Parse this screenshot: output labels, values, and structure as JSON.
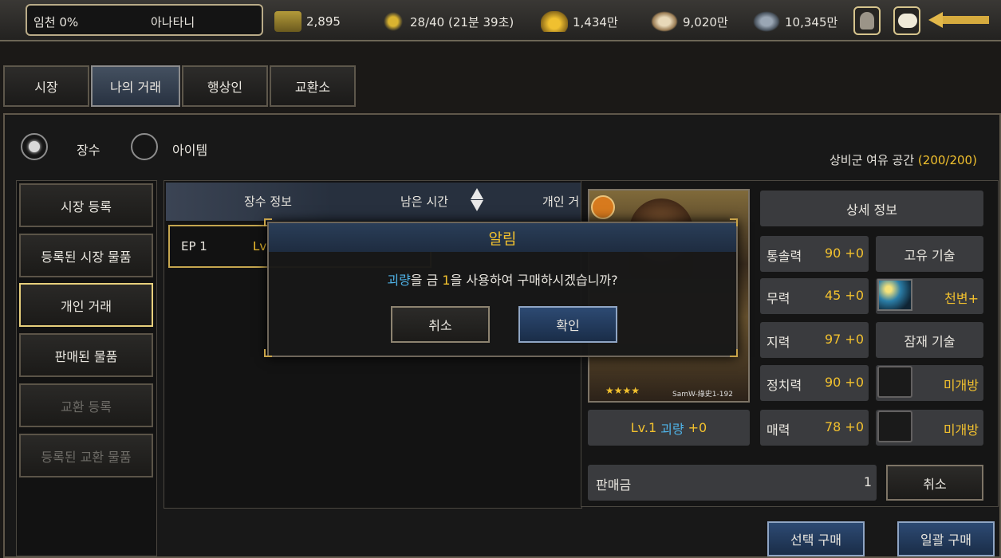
{
  "topbar": {
    "rank": "임천 0%",
    "nickname": "아나타니",
    "resources": [
      {
        "icon": "scroll-icon",
        "value": "2,895"
      },
      {
        "icon": "stamina-runner-icon",
        "value": "28/40 (21분 39초)"
      },
      {
        "icon": "gold-ingot-icon",
        "value": "1,434만"
      },
      {
        "icon": "food-sack-icon",
        "value": "9,020만"
      },
      {
        "icon": "iron-ore-icon",
        "value": "10,345만"
      }
    ]
  },
  "tabs": [
    "시장",
    "나의 거래",
    "행상인",
    "교환소"
  ],
  "filter": {
    "general": "장수",
    "item": "아이템"
  },
  "reserve_space": {
    "label": "상비군 여유 공간",
    "value": "(200/200)"
  },
  "sidebar": [
    "시장 등록",
    "등록된 시장 물품",
    "개인 거래",
    "판매된 물품",
    "교환 등록",
    "등록된 교환 물품"
  ],
  "list_header": {
    "info": "장수 정보",
    "time": "남은 시간",
    "personal": "개인 거"
  },
  "row": {
    "ep": "EP 1",
    "lv": "Lv"
  },
  "detail": {
    "card_stars": "★★★★",
    "card_caption": "SamW-綠史1-192",
    "level_prefix": "Lv.1",
    "general_name": "괴량",
    "level_suffix": "+0",
    "detail_info_btn": "상세 정보",
    "stats": [
      {
        "label": "통솔력",
        "value": "90 +0"
      },
      {
        "label": "무력",
        "value": "45 +0"
      },
      {
        "label": "지력",
        "value": "97 +0"
      },
      {
        "label": "정치력",
        "value": "90 +0"
      },
      {
        "label": "매력",
        "value": "78 +0"
      }
    ],
    "unique_skill_btn": "고유 기술",
    "unique_skill_name": "천변+",
    "potential_skill_btn": "잠재 기술",
    "slot1": "미개방",
    "slot2": "미개방",
    "price_label": "판매금",
    "price_value": "1",
    "cancel_btn": "취소"
  },
  "bottom": {
    "select_buy": "선택 구매",
    "bulk_buy": "일괄 구매"
  },
  "dialog": {
    "title": "알림",
    "name": "괴량",
    "msg_a": "을 금 ",
    "amount": "1",
    "msg_b": "을 사용하여 구매하시겠습니까?",
    "cancel": "취소",
    "confirm": "확인"
  },
  "colors": {
    "gold": "#f2c12e",
    "cyan": "#4fb3e8"
  }
}
